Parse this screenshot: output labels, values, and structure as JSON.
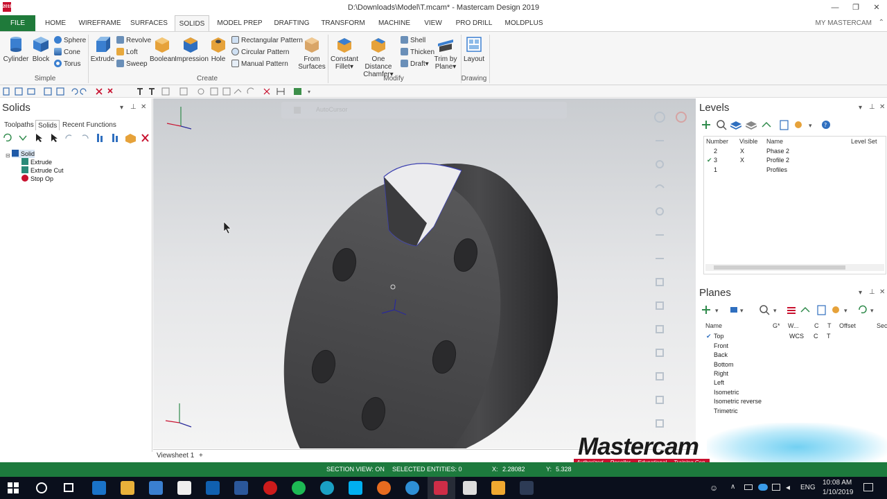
{
  "window": {
    "title": "D:\\Downloads\\Model\\T.mcam* - Mastercam Design 2019",
    "logo_text": "2019",
    "minimize": "—",
    "restore": "❐",
    "close": "✕"
  },
  "ribbon_tabs": [
    "FILE",
    "HOME",
    "WIREFRAME",
    "SURFACES",
    "SOLIDS",
    "MODEL PREP",
    "DRAFTING",
    "TRANSFORM",
    "MACHINE",
    "VIEW",
    "PRO DRILL",
    "MOLDPLUS"
  ],
  "active_tab": "SOLIDS",
  "my_mastercam": "MY MASTERCAM",
  "ribbon": {
    "simple": {
      "cylinder": "Cylinder",
      "block": "Block",
      "sphere": "Sphere",
      "cone": "Cone",
      "torus": "Torus",
      "group": "Simple"
    },
    "create": {
      "extrude": "Extrude",
      "revolve": "Revolve",
      "loft": "Loft",
      "sweep": "Sweep",
      "boolean": "Boolean",
      "impression": "Impression",
      "hole": "Hole",
      "rect_pattern": "Rectangular Pattern",
      "circ_pattern": "Circular Pattern",
      "manual_pattern": "Manual Pattern",
      "from_surfaces_1": "From",
      "from_surfaces_2": "Surfaces",
      "group": "Create"
    },
    "modify": {
      "const_fillet_1": "Constant",
      "const_fillet_2": "Fillet",
      "one_dist_chamfer_1": "One Distance",
      "one_dist_chamfer_2": "Chamfer",
      "shell": "Shell",
      "thicken": "Thicken",
      "draft": "Draft",
      "trim_by_plane_1": "Trim by",
      "trim_by_plane_2": "Plane",
      "group": "Modify"
    },
    "drawing": {
      "layout": "Layout",
      "group": "Drawing"
    }
  },
  "solids_panel": {
    "title": "Solids",
    "tabs": [
      "Toolpaths",
      "Solids",
      "Recent Functions"
    ],
    "active_tab": "Solids",
    "tree": [
      {
        "label": "Solid",
        "level": 0
      },
      {
        "label": "Extrude",
        "level": 1
      },
      {
        "label": "Extrude Cut",
        "level": 1
      },
      {
        "label": "Stop Op",
        "level": 1
      }
    ]
  },
  "viewport": {
    "autocursor_label": "AutoCursor",
    "viewsheet_tab": "Viewsheet 1",
    "add_tab": "+"
  },
  "levels_panel": {
    "title": "Levels",
    "columns": [
      "Number",
      "Visible",
      "Name",
      "Level Set"
    ],
    "rows": [
      {
        "active": "",
        "number": "2",
        "visible": "X",
        "name": "Phase 2"
      },
      {
        "active": "✔",
        "number": "3",
        "visible": "X",
        "name": "Profile 2"
      },
      {
        "active": "",
        "number": "1",
        "visible": "",
        "name": "Profiles"
      }
    ]
  },
  "planes_panel": {
    "title": "Planes",
    "columns": [
      "Name",
      "G*",
      "W...",
      "C",
      "T",
      "Offset",
      "Sec"
    ],
    "rows": [
      {
        "active": "✔",
        "name": "Top",
        "w": "WCS",
        "c": "C",
        "t": "T"
      },
      {
        "active": "",
        "name": "Front",
        "w": "",
        "c": "",
        "t": ""
      },
      {
        "active": "",
        "name": "Back",
        "w": "",
        "c": "",
        "t": ""
      },
      {
        "active": "",
        "name": "Bottom",
        "w": "",
        "c": "",
        "t": ""
      },
      {
        "active": "",
        "name": "Right",
        "w": "",
        "c": "",
        "t": ""
      },
      {
        "active": "",
        "name": "Left",
        "w": "",
        "c": "",
        "t": ""
      },
      {
        "active": "",
        "name": "Isometric",
        "w": "",
        "c": "",
        "t": ""
      },
      {
        "active": "",
        "name": "Isometric reverse",
        "w": "",
        "c": "",
        "t": ""
      },
      {
        "active": "",
        "name": "Trimetric",
        "w": "",
        "c": "",
        "t": ""
      }
    ]
  },
  "statusbar": {
    "section_view": "SECTION VIEW: ON",
    "selected": "SELECTED ENTITIES: 0",
    "x_label": "X:",
    "x_value": "2.28082",
    "y_label": "Y:",
    "y_value": "5.328"
  },
  "watermark": {
    "brand": "Mastercam",
    "tags": [
      "Authorized",
      "Reseller",
      "Educational",
      "Training Cen"
    ]
  },
  "taskbar": {
    "lang": "ENG",
    "time": "10:08 AM",
    "date": "1/10/2019"
  },
  "colors": {
    "accent_green": "#1d7a3d",
    "file_tab": "#1f7a3a",
    "brand_red": "#c8102e"
  }
}
